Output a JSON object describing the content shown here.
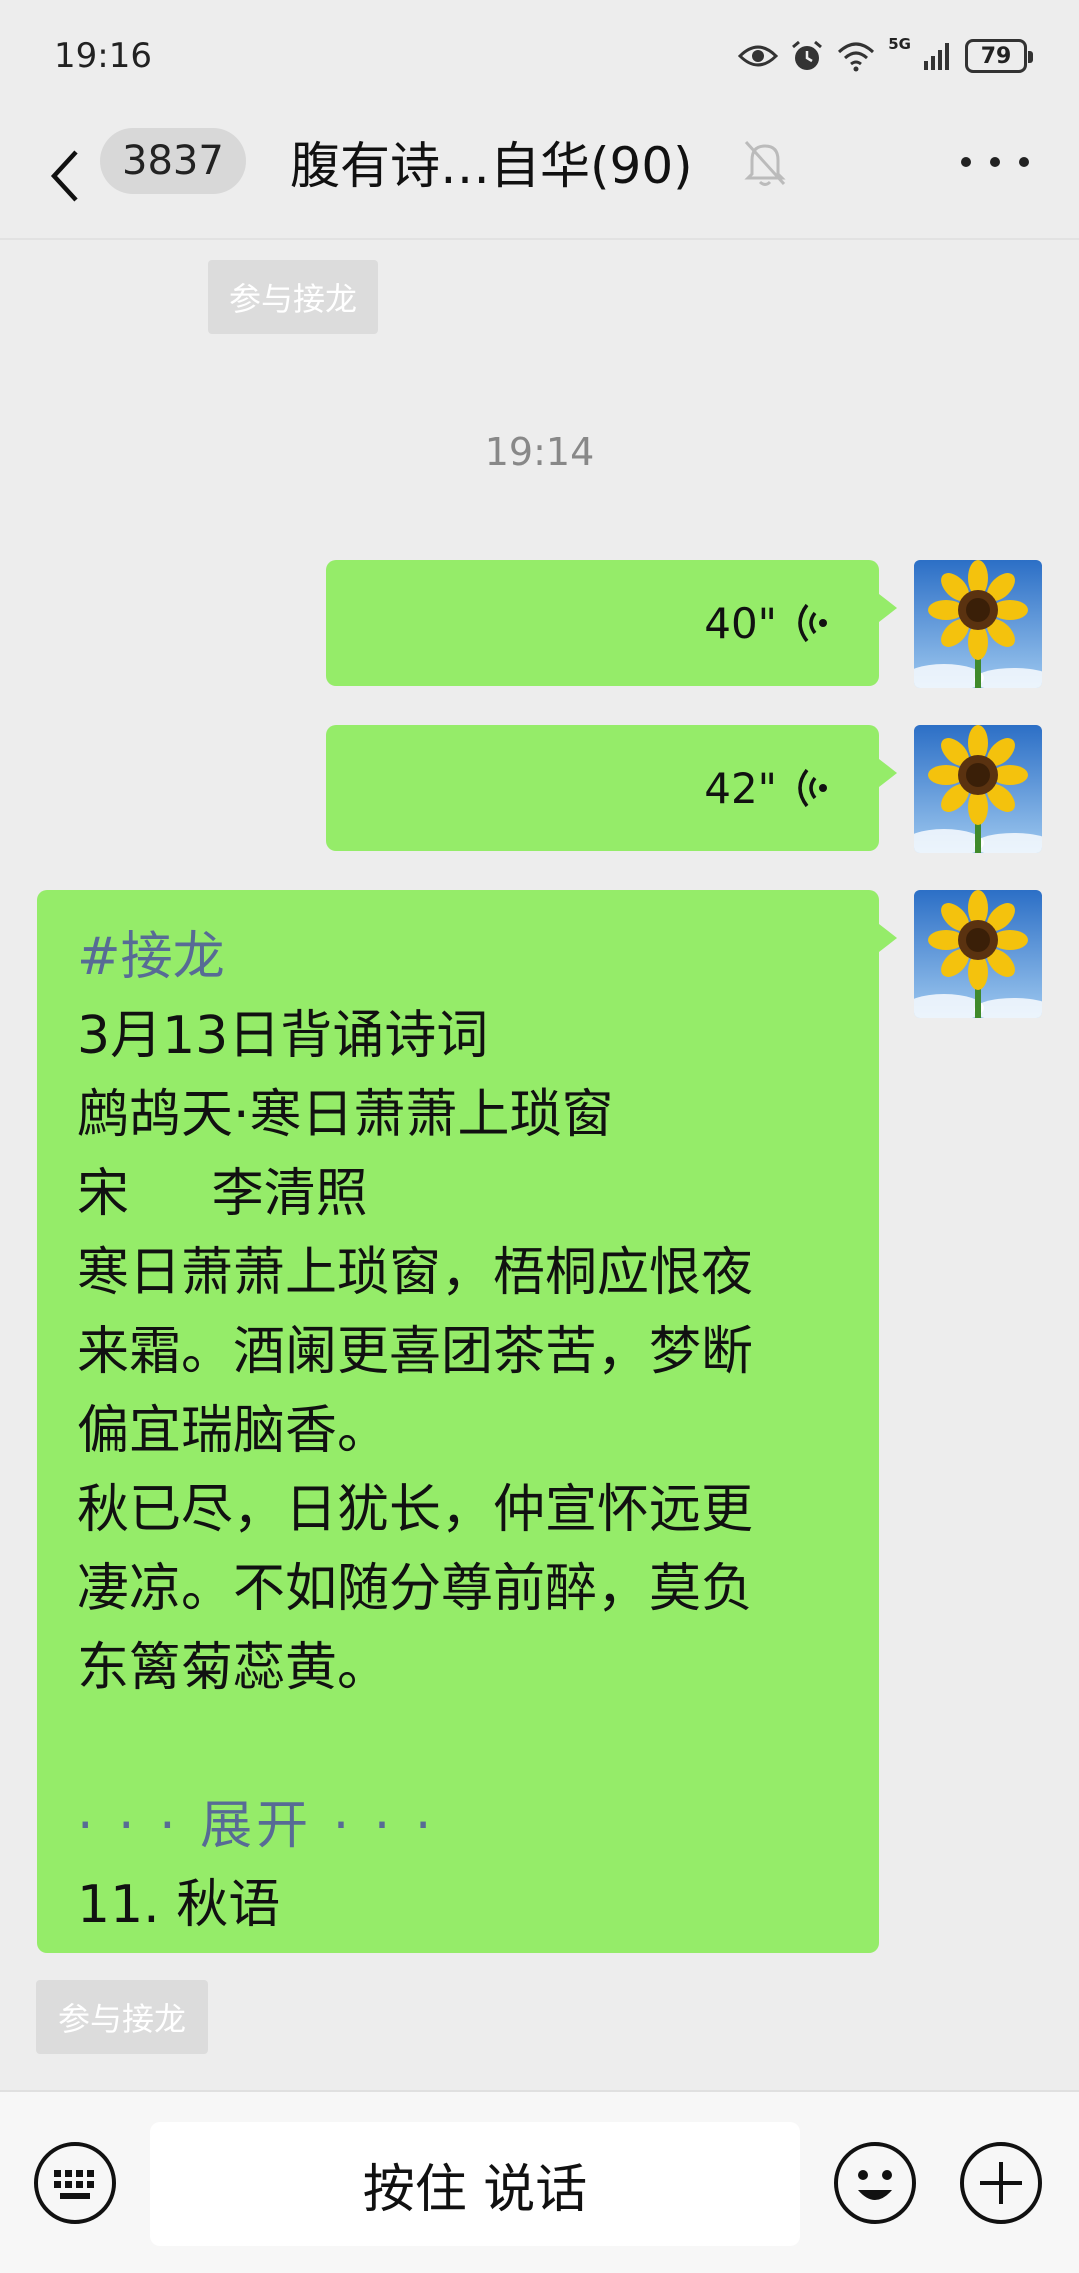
{
  "status_bar": {
    "time": "19:16",
    "battery": "79",
    "network": "5G"
  },
  "nav": {
    "unread_count": "3837",
    "title": "腹有诗…自华(90)"
  },
  "join_chip_top": "参与接龙",
  "timestamp": "19:14",
  "voice_messages": [
    {
      "duration": "40\""
    },
    {
      "duration": "42\""
    }
  ],
  "text_message": {
    "tag": "#接龙",
    "lines": [
      "3月13日背诵诗词",
      "鹧鸪天·寒日萧萧上琐窗",
      "宋     李清照",
      "寒日萧萧上琐窗，梧桐应恨夜",
      "来霜。酒阑更喜团茶苦，梦断",
      "偏宜瑞脑香。",
      "秋已尽，日犹长，仲宣怀远更",
      "凄凉。不如随分尊前醉，莫负",
      "东篱菊蕊黄。"
    ],
    "expand_label": "· · · 展开 · · ·",
    "last_entry": "11. 秋语"
  },
  "join_chip_bottom": "参与接龙",
  "input_bar": {
    "hold_to_talk": "按住 说话"
  },
  "colors": {
    "bubble_green": "#95ec69",
    "link_blue": "#576b95",
    "background": "#ededed"
  }
}
